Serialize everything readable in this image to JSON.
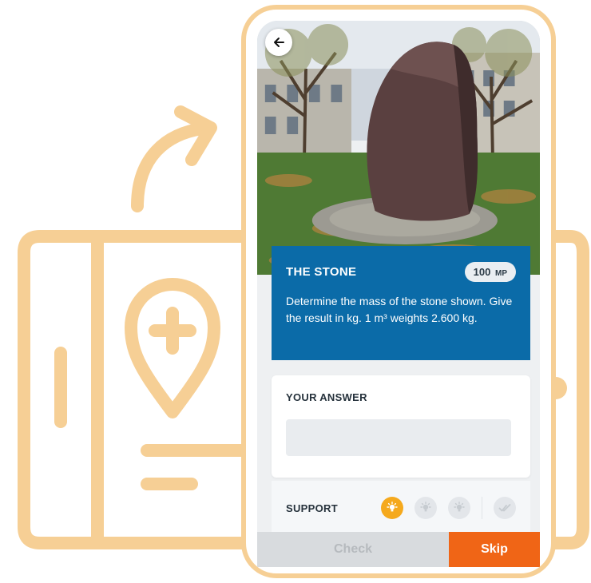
{
  "colors": {
    "illustration": "#f6cf95",
    "task_card": "#0b6ba8",
    "skip_button": "#f06516",
    "check_button": "#d8dbde",
    "hint_active": "#f5a91d"
  },
  "header": {
    "back_icon": "arrow-left-icon"
  },
  "task": {
    "title": "THE STONE",
    "points": "100",
    "points_unit": "MP",
    "description": "Determine the mass of the stone shown. Give the result in kg. 1 m³ weights 2.600 kg."
  },
  "answer": {
    "label": "YOUR ANSWER",
    "value": ""
  },
  "support": {
    "label": "SUPPORT",
    "hints": [
      {
        "icon": "lightbulb-icon",
        "active": true
      },
      {
        "icon": "lightbulb-icon",
        "active": false
      },
      {
        "icon": "lightbulb-icon",
        "active": false
      },
      {
        "icon": "double-check-icon",
        "active": false
      }
    ]
  },
  "buttons": {
    "check": "Check",
    "skip": "Skip"
  }
}
